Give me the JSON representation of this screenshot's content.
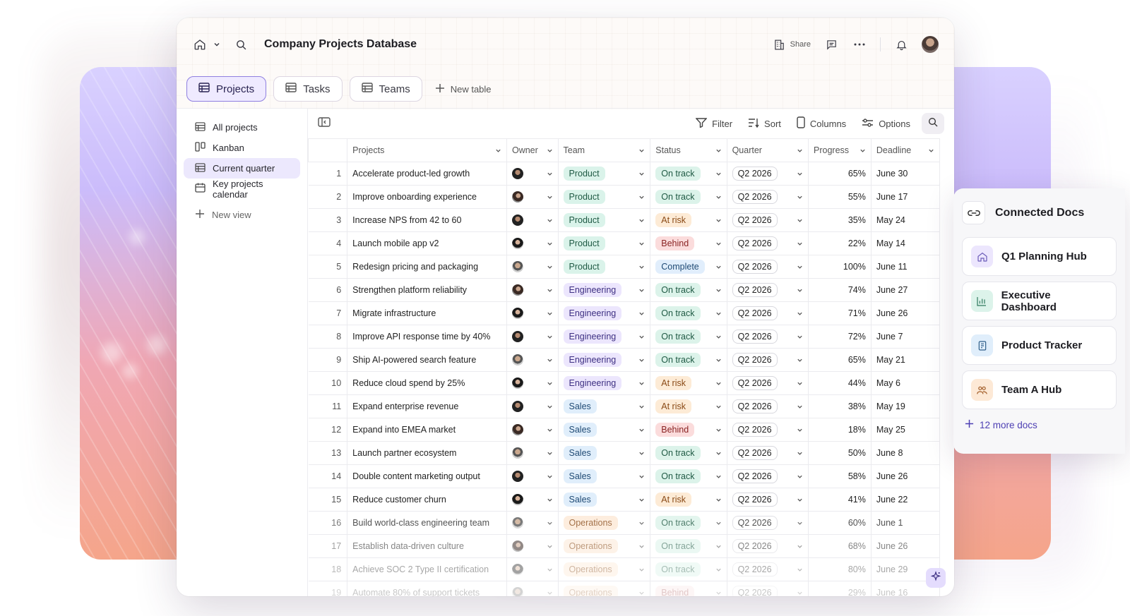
{
  "header": {
    "title": "Company Projects Database",
    "share_label": "Share"
  },
  "tabs": [
    {
      "label": "Projects",
      "active": true
    },
    {
      "label": "Tasks",
      "active": false
    },
    {
      "label": "Teams",
      "active": false
    }
  ],
  "new_table_label": "New table",
  "sidebar": {
    "items": [
      {
        "label": "All projects",
        "icon": "table-icon",
        "active": false
      },
      {
        "label": "Kanban",
        "icon": "kanban-icon",
        "active": false
      },
      {
        "label": "Current quarter",
        "icon": "table-icon",
        "active": true
      },
      {
        "label": "Key projects calendar",
        "icon": "calendar-icon",
        "active": false
      }
    ],
    "new_view_label": "New view"
  },
  "toolbar": {
    "filter": "Filter",
    "sort": "Sort",
    "columns": "Columns",
    "options": "Options"
  },
  "table": {
    "columns": [
      "Projects",
      "Owner",
      "Team",
      "Status",
      "Quarter",
      "Progress",
      "Deadline"
    ],
    "rows": [
      {
        "n": "1",
        "project": "Accelerate product-led growth",
        "owner": "a",
        "team": "Product",
        "status": "On track",
        "quarter": "Q2 2026",
        "progress": "65%",
        "deadline": "June 30"
      },
      {
        "n": "2",
        "project": "Improve onboarding experience",
        "owner": "b",
        "team": "Product",
        "status": "On track",
        "quarter": "Q2 2026",
        "progress": "55%",
        "deadline": "June 17"
      },
      {
        "n": "3",
        "project": "Increase NPS from 42 to 60",
        "owner": "a",
        "team": "Product",
        "status": "At risk",
        "quarter": "Q2 2026",
        "progress": "35%",
        "deadline": "May 24"
      },
      {
        "n": "4",
        "project": "Launch mobile app v2",
        "owner": "c",
        "team": "Product",
        "status": "Behind",
        "quarter": "Q2 2026",
        "progress": "22%",
        "deadline": "May 14"
      },
      {
        "n": "5",
        "project": "Redesign pricing and packaging",
        "owner": "d",
        "team": "Product",
        "status": "Complete",
        "quarter": "Q2 2026",
        "progress": "100%",
        "deadline": "June 11"
      },
      {
        "n": "6",
        "project": "Strengthen platform reliability",
        "owner": "b",
        "team": "Engineering",
        "status": "On track",
        "quarter": "Q2 2026",
        "progress": "74%",
        "deadline": "June 27"
      },
      {
        "n": "7",
        "project": "Migrate infrastructure",
        "owner": "c",
        "team": "Engineering",
        "status": "On track",
        "quarter": "Q2 2026",
        "progress": "71%",
        "deadline": "June 26"
      },
      {
        "n": "8",
        "project": "Improve API response time by 40%",
        "owner": "a",
        "team": "Engineering",
        "status": "On track",
        "quarter": "Q2 2026",
        "progress": "72%",
        "deadline": "June 7"
      },
      {
        "n": "9",
        "project": "Ship AI-powered search feature",
        "owner": "d",
        "team": "Engineering",
        "status": "On track",
        "quarter": "Q2 2026",
        "progress": "65%",
        "deadline": "May 21"
      },
      {
        "n": "10",
        "project": "Reduce cloud spend by 25%",
        "owner": "c",
        "team": "Engineering",
        "status": "At risk",
        "quarter": "Q2 2026",
        "progress": "44%",
        "deadline": "May 6"
      },
      {
        "n": "11",
        "project": "Expand enterprise revenue",
        "owner": "a",
        "team": "Sales",
        "status": "At risk",
        "quarter": "Q2 2026",
        "progress": "38%",
        "deadline": "May 19"
      },
      {
        "n": "12",
        "project": "Expand into EMEA market",
        "owner": "b",
        "team": "Sales",
        "status": "Behind",
        "quarter": "Q2 2026",
        "progress": "18%",
        "deadline": "May 25"
      },
      {
        "n": "13",
        "project": "Launch partner ecosystem",
        "owner": "d",
        "team": "Sales",
        "status": "On track",
        "quarter": "Q2 2026",
        "progress": "50%",
        "deadline": "June 8"
      },
      {
        "n": "14",
        "project": "Double content marketing output",
        "owner": "a",
        "team": "Sales",
        "status": "On track",
        "quarter": "Q2 2026",
        "progress": "58%",
        "deadline": "June 26"
      },
      {
        "n": "15",
        "project": "Reduce customer churn",
        "owner": "c",
        "team": "Sales",
        "status": "At risk",
        "quarter": "Q2 2026",
        "progress": "41%",
        "deadline": "June 22"
      },
      {
        "n": "16",
        "project": "Build world-class engineering team",
        "owner": "d",
        "team": "Operations",
        "status": "On track",
        "quarter": "Q2 2026",
        "progress": "60%",
        "deadline": "June 1"
      },
      {
        "n": "17",
        "project": "Establish data-driven culture",
        "owner": "b",
        "team": "Operations",
        "status": "On track",
        "quarter": "Q2 2026",
        "progress": "68%",
        "deadline": "June 26"
      },
      {
        "n": "18",
        "project": "Achieve SOC 2 Type II certification",
        "owner": "c",
        "team": "Operations",
        "status": "On track",
        "quarter": "Q2 2026",
        "progress": "80%",
        "deadline": "June 29"
      },
      {
        "n": "19",
        "project": "Automate 80% of support tickets",
        "owner": "d",
        "team": "Operations",
        "status": "Behind",
        "quarter": "Q2 2026",
        "progress": "29%",
        "deadline": "June 16"
      }
    ]
  },
  "connected_docs": {
    "title": "Connected Docs",
    "docs": [
      {
        "label": "Q1 Planning Hub",
        "icon": "home-icon",
        "color": "#ece6fd"
      },
      {
        "label": "Executive Dashboard",
        "icon": "bar-chart-icon",
        "color": "#dcf3ea"
      },
      {
        "label": "Product Tracker",
        "icon": "document-icon",
        "color": "#e0eefb"
      },
      {
        "label": "Team A Hub",
        "icon": "people-icon",
        "color": "#fde9d6"
      }
    ],
    "more_label": "12 more docs"
  }
}
